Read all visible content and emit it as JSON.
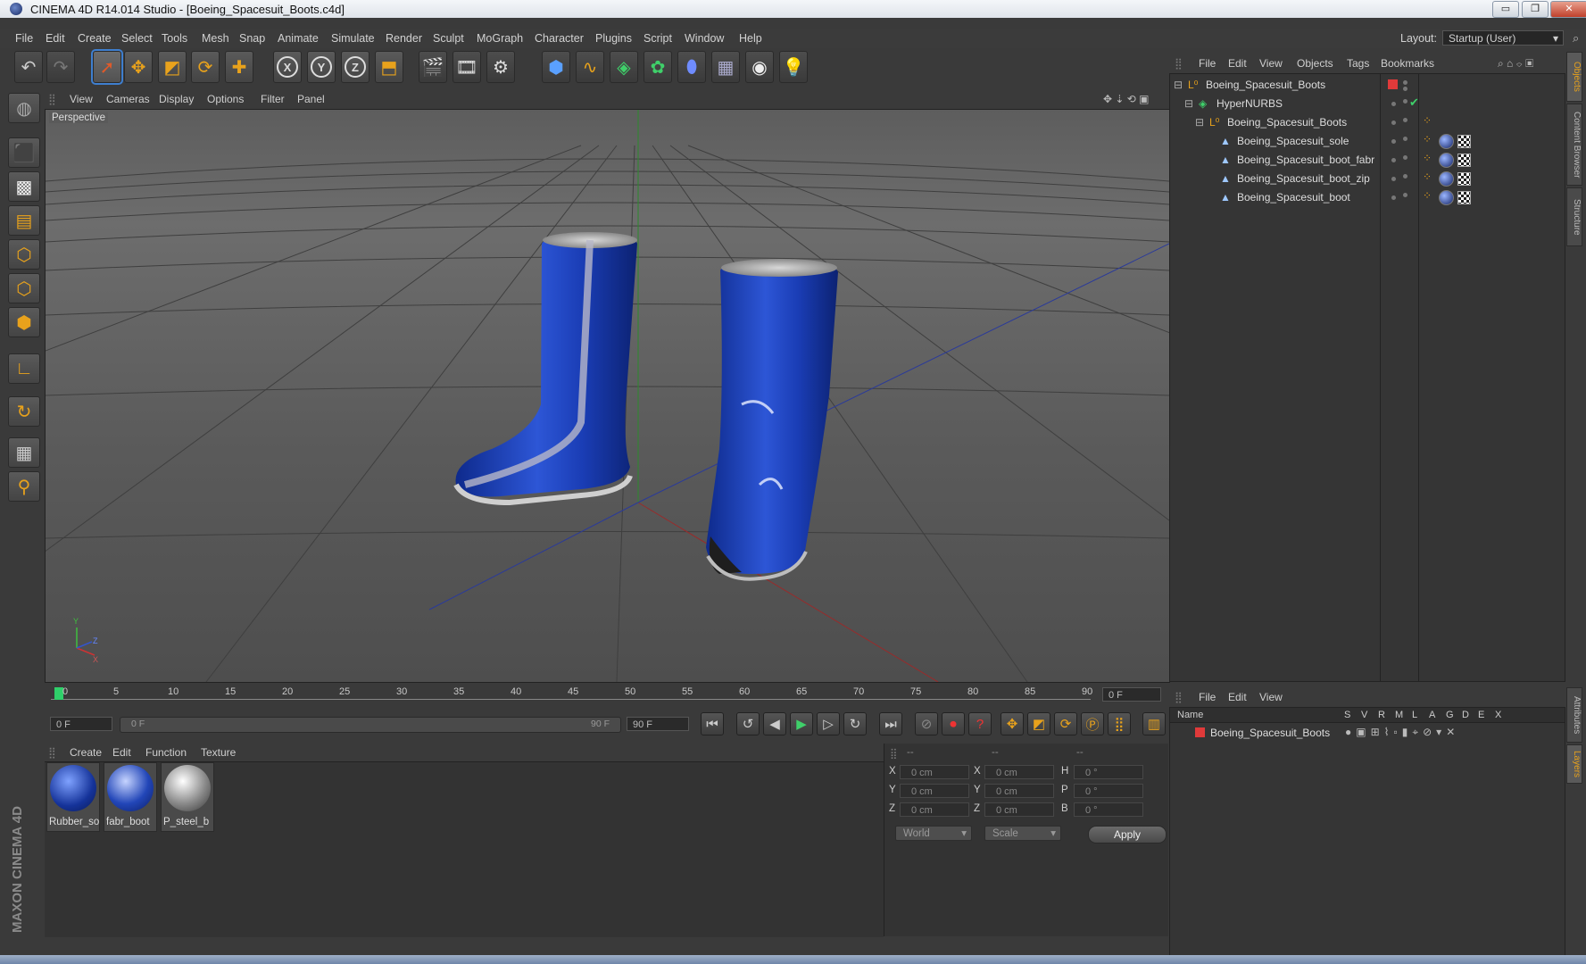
{
  "window": {
    "title": "CINEMA 4D R14.014 Studio - [Boeing_Spacesuit_Boots.c4d]",
    "minimize": "▭",
    "restore": "❐",
    "close": "✕"
  },
  "menubar": {
    "items": [
      "File",
      "Edit",
      "Create",
      "Select",
      "Tools",
      "Mesh",
      "Snap",
      "Animate",
      "Simulate",
      "Render",
      "Sculpt",
      "MoGraph",
      "Character",
      "Plugins",
      "Script",
      "Window",
      "Help"
    ],
    "layout_label": "Layout:",
    "layout_value": "Startup (User)"
  },
  "toolbar": {
    "icons": [
      "undo-icon",
      "redo-icon",
      "select-icon",
      "move-icon",
      "scale-icon",
      "rotate-icon",
      "add-icon",
      "x-axis-icon",
      "y-axis-icon",
      "z-axis-icon",
      "coord-system-icon",
      "render-view-icon",
      "render-picture-viewer-icon",
      "render-settings-icon",
      "cube-icon",
      "spline-icon",
      "nurbs-icon",
      "array-icon",
      "deformer-icon",
      "floor-icon",
      "camera-icon",
      "light-icon"
    ],
    "x_label": "X",
    "y_label": "Y",
    "z_label": "Z"
  },
  "viewport": {
    "menu": [
      "View",
      "Cameras",
      "Display",
      "Options",
      "Filter",
      "Panel"
    ],
    "camera_label": "Perspective",
    "axis_y": "Y",
    "axis_z": "Z",
    "axis_x": "X"
  },
  "timeline": {
    "ticks": [
      "0",
      "5",
      "10",
      "15",
      "20",
      "25",
      "30",
      "35",
      "40",
      "45",
      "50",
      "55",
      "60",
      "65",
      "70",
      "75",
      "80",
      "85",
      "90"
    ],
    "current_frame_field": "0 F",
    "start_field": "0 F",
    "range_start": "0 F",
    "range_end": "90 F",
    "end_field": "90 F"
  },
  "materials": {
    "menu": [
      "Create",
      "Edit",
      "Function",
      "Texture"
    ],
    "items": [
      {
        "name": "Rubber_so"
      },
      {
        "name": "fabr_boot"
      },
      {
        "name": "P_steel_b"
      }
    ]
  },
  "coordinates": {
    "headers": [
      "--",
      "--",
      "--"
    ],
    "rows": [
      {
        "a": "X",
        "av": "0 cm",
        "b": "X",
        "bv": "0 cm",
        "c": "H",
        "cv": "0 °"
      },
      {
        "a": "Y",
        "av": "0 cm",
        "b": "Y",
        "bv": "0 cm",
        "c": "P",
        "cv": "0 °"
      },
      {
        "a": "Z",
        "av": "0 cm",
        "b": "Z",
        "bv": "0 cm",
        "c": "B",
        "cv": "0 °"
      }
    ],
    "mode": "World",
    "transform": "Scale",
    "apply": "Apply"
  },
  "objects": {
    "menu": [
      "File",
      "Edit",
      "View",
      "Objects",
      "Tags",
      "Bookmarks"
    ],
    "tree": [
      {
        "name": "Boeing_Spacesuit_Boots"
      },
      {
        "name": "HyperNURBS"
      },
      {
        "name": "Boeing_Spacesuit_Boots"
      },
      {
        "name": "Boeing_Spacesuit_sole"
      },
      {
        "name": "Boeing_Spacesuit_boot_fabr"
      },
      {
        "name": "Boeing_Spacesuit_boot_zip"
      },
      {
        "name": "Boeing_Spacesuit_boot"
      }
    ]
  },
  "layers": {
    "menu": [
      "File",
      "Edit",
      "View"
    ],
    "columns": [
      "Name",
      "S",
      "V",
      "R",
      "M",
      "L",
      "A",
      "G",
      "D",
      "E",
      "X"
    ],
    "items": [
      {
        "name": "Boeing_Spacesuit_Boots",
        "color": "#e03a3a"
      }
    ]
  },
  "side_tabs": [
    "Objects",
    "Content Browser",
    "Structure",
    "Attributes",
    "Layers"
  ],
  "branding": "MAXON CINEMA 4D",
  "colors": {
    "accent": "#e8a21c",
    "boot_blue": "#1d3fb0",
    "selection": "#3f7fcf"
  }
}
